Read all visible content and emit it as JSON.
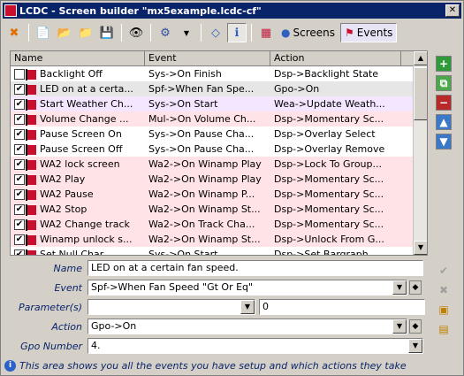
{
  "window": {
    "title": "LCDC - Screen builder \"mx5example.lcdc-cf\""
  },
  "toolbar": {
    "screens_label": "Screens",
    "events_label": "Events"
  },
  "grid": {
    "columns": [
      "Name",
      "Event",
      "Action"
    ],
    "rows": [
      {
        "name": "Backlight Off",
        "event": "Sys->On Finish",
        "action": "Dsp->Backlight State",
        "checked": false,
        "style": "white"
      },
      {
        "name": "LED on at a certa...",
        "event": "Spf->When Fan Spe...",
        "action": "Gpo->On",
        "checked": true,
        "style": "gray"
      },
      {
        "name": "Start Weather Ch...",
        "event": "Sys->On Start",
        "action": "Wea->Update Weath...",
        "checked": true,
        "style": "lav"
      },
      {
        "name": "Volume Change ...",
        "event": "Mul->On Volume Ch...",
        "action": "Dsp->Momentary Sc...",
        "checked": true,
        "style": "pink"
      },
      {
        "name": "Pause Screen On",
        "event": "Sys->On Pause Cha...",
        "action": "Dsp->Overlay Select",
        "checked": true,
        "style": "white"
      },
      {
        "name": "Pause Screen Off",
        "event": "Sys->On Pause Cha...",
        "action": "Dsp->Overlay Remove",
        "checked": true,
        "style": "white"
      },
      {
        "name": "WA2 lock screen",
        "event": "Wa2->On Winamp Play",
        "action": "Dsp->Lock To Group...",
        "checked": true,
        "style": "pink"
      },
      {
        "name": "WA2 Play",
        "event": "Wa2->On Winamp Play",
        "action": "Dsp->Momentary Sc...",
        "checked": true,
        "style": "pink"
      },
      {
        "name": "WA2 Pause",
        "event": "Wa2->On Winamp P...",
        "action": "Dsp->Momentary Sc...",
        "checked": true,
        "style": "pink"
      },
      {
        "name": "WA2 Stop",
        "event": "Wa2->On Winamp St...",
        "action": "Dsp->Momentary Sc...",
        "checked": true,
        "style": "pink"
      },
      {
        "name": "WA2 Change track",
        "event": "Wa2->On Track Cha...",
        "action": "Dsp->Momentary Sc...",
        "checked": true,
        "style": "pink"
      },
      {
        "name": "Winamp unlock s...",
        "event": "Wa2->On Winamp St...",
        "action": "Dsp->Unlock From G...",
        "checked": true,
        "style": "pink"
      },
      {
        "name": "Set Null Char",
        "event": "Sys->On Start",
        "action": "Dsp->Set Bargraph",
        "checked": true,
        "style": "white"
      }
    ]
  },
  "form": {
    "name_label": "Name",
    "name_value": "LED on at a certain fan speed.",
    "event_label": "Event",
    "event_value": "Spf->When Fan Speed \"Gt Or Eq\"",
    "params_label": "Parameter(s)",
    "params_value": "",
    "params_number": "0",
    "action_label": "Action",
    "action_value": "Gpo->On",
    "gpo_label": "Gpo Number",
    "gpo_value": "4."
  },
  "status": {
    "text": "This area shows you all the events you have setup and which actions they take"
  }
}
